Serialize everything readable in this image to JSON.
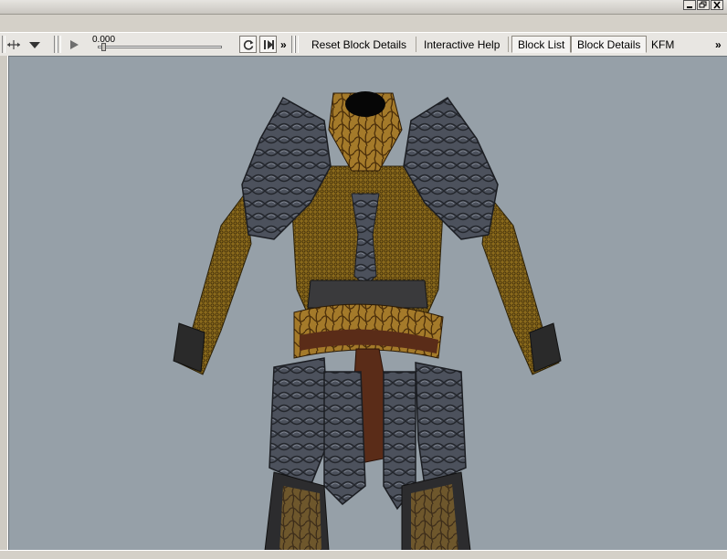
{
  "toolbar": {
    "time_value": "0.000",
    "reset_block_details": "Reset Block Details",
    "interactive_help": "Interactive Help",
    "overflow_glyph": "»",
    "tabs": [
      {
        "label": "Block List",
        "active": true
      },
      {
        "label": "Block Details",
        "active": true
      },
      {
        "label": "KFM",
        "active": false
      }
    ]
  },
  "colors": {
    "viewport_background": "#96a0a8",
    "chain_mail": "#8a6a1c",
    "metal_plate": "#4a4e58",
    "belt": "#5a2c18"
  },
  "icons": [
    "move-icon",
    "dropdown-arrow-icon",
    "play-icon",
    "loop-icon",
    "step-play-icon",
    "minimize-icon",
    "restore-icon",
    "close-icon"
  ]
}
